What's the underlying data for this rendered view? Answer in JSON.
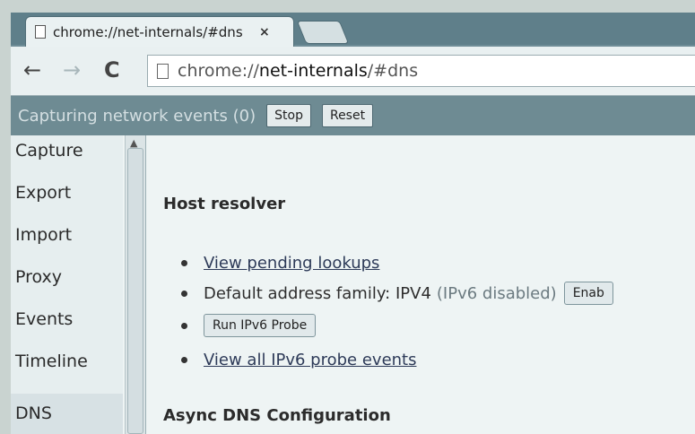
{
  "tab": {
    "title": "chrome://net-internals/#dns",
    "close": "×"
  },
  "toolbar": {
    "back": "←",
    "forward": "→",
    "reload": "C",
    "url_scheme": "chrome://",
    "url_host": "net-internals",
    "url_path": "/#dns"
  },
  "capture_bar": {
    "status": "Capturing network events (0)",
    "stop_label": "Stop",
    "reset_label": "Reset"
  },
  "sidebar": {
    "items": [
      {
        "label": "Capture"
      },
      {
        "label": "Export"
      },
      {
        "label": "Import"
      },
      {
        "label": "Proxy"
      },
      {
        "label": "Events"
      },
      {
        "label": "Timeline"
      },
      {
        "label": "DNS",
        "selected": true
      }
    ]
  },
  "main": {
    "host_resolver_title": "Host resolver",
    "view_pending_lookups": "View pending lookups",
    "default_family_label": "Default address family: IPV4",
    "ipv6_status": "(IPv6 disabled)",
    "enable_button": "Enab",
    "run_probe_button": "Run IPv6 Probe",
    "view_probe_events": "View all IPv6 probe events",
    "async_dns_title": "Async DNS Configuration"
  }
}
